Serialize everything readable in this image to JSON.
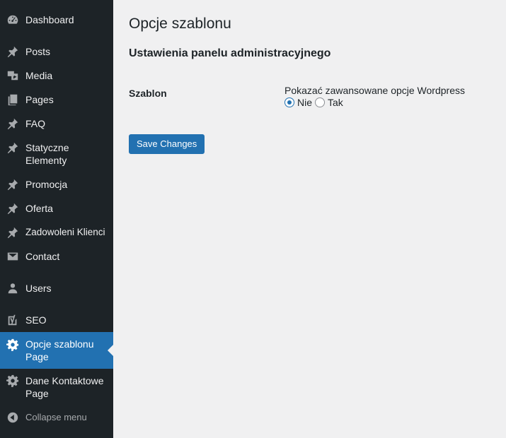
{
  "sidebar": {
    "items": [
      {
        "label": "Dashboard",
        "icon": "dashboard-icon"
      },
      {
        "label": "Posts",
        "icon": "pin-icon"
      },
      {
        "label": "Media",
        "icon": "media-icon"
      },
      {
        "label": "Pages",
        "icon": "pages-icon"
      },
      {
        "label": "FAQ",
        "icon": "pin-icon"
      },
      {
        "label": "Statyczne Elementy",
        "icon": "pin-icon"
      },
      {
        "label": "Promocja",
        "icon": "pin-icon"
      },
      {
        "label": "Oferta",
        "icon": "pin-icon"
      },
      {
        "label": "Zadowoleni Klienci",
        "icon": "pin-icon"
      },
      {
        "label": "Contact",
        "icon": "mail-icon"
      },
      {
        "label": "Users",
        "icon": "user-icon"
      },
      {
        "label": "SEO",
        "icon": "yoast-icon"
      },
      {
        "label": "Opcje szablonu Page",
        "icon": "gear-icon",
        "active": true
      },
      {
        "label": "Dane Kontaktowe Page",
        "icon": "gear-icon"
      }
    ],
    "collapse_label": "Collapse menu",
    "colors": {
      "bg": "#1d2327",
      "active": "#2271b1",
      "icon": "#a7aaad"
    }
  },
  "main": {
    "title": "Opcje szablonu",
    "section_title": "Ustawienia panelu administracyjnego",
    "setting": {
      "label": "Szablon",
      "description": "Pokazać zawansowane opcje Wordpress",
      "options": [
        {
          "label": "Nie",
          "checked": true
        },
        {
          "label": "Tak",
          "checked": false
        }
      ]
    },
    "save_label": "Save Changes"
  }
}
